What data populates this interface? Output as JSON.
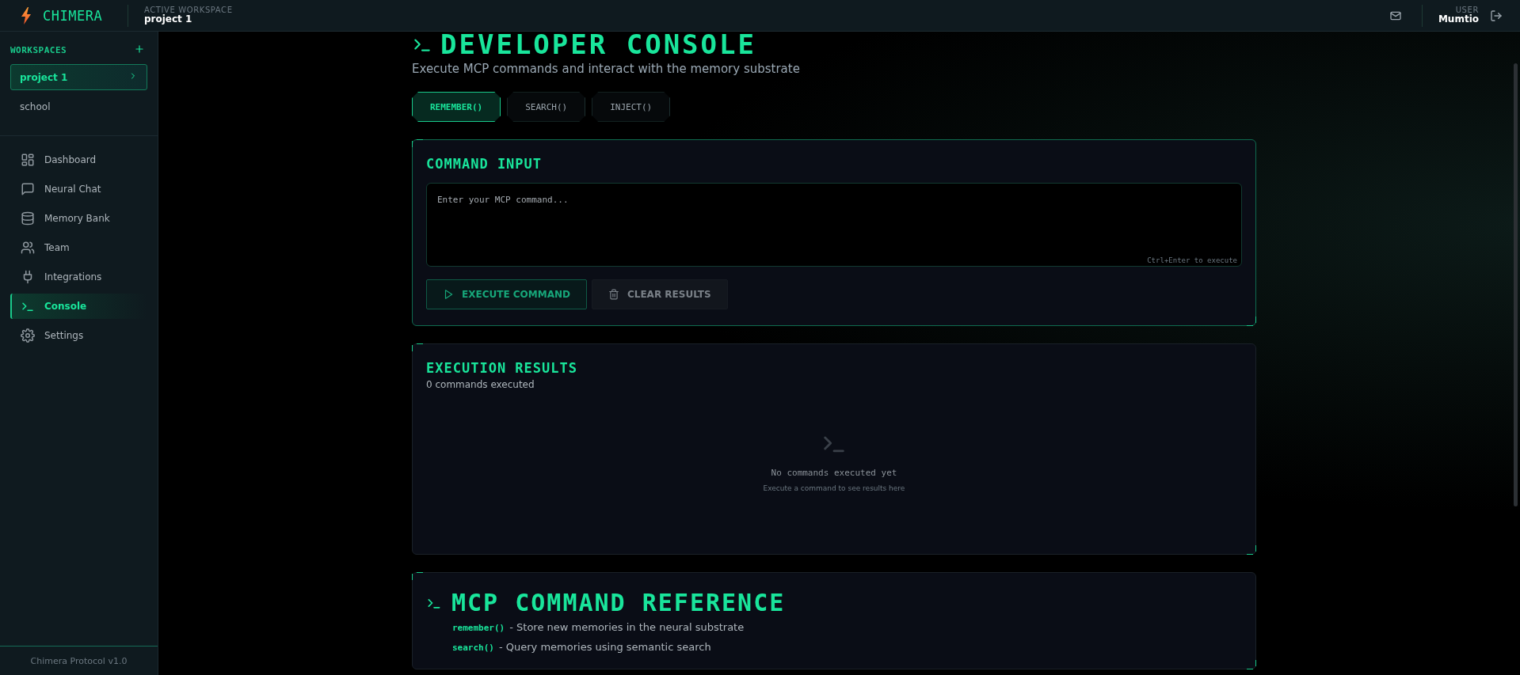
{
  "brand": {
    "name": "CHIMERA"
  },
  "workspace": {
    "label": "ACTIVE WORKSPACE",
    "name": "project 1"
  },
  "user": {
    "label": "USER",
    "name": "Mumtio"
  },
  "sidebar": {
    "workspaces_title": "WORKSPACES",
    "workspaces": [
      {
        "name": "project 1",
        "selected": true
      },
      {
        "name": "school",
        "selected": false
      }
    ],
    "nav": [
      {
        "label": "Dashboard",
        "selected": false
      },
      {
        "label": "Neural Chat",
        "selected": false
      },
      {
        "label": "Memory Bank",
        "selected": false
      },
      {
        "label": "Team",
        "selected": false
      },
      {
        "label": "Integrations",
        "selected": false
      },
      {
        "label": "Console",
        "selected": true
      },
      {
        "label": "Settings",
        "selected": false
      }
    ],
    "footer": "Chimera Protocol v1.0"
  },
  "page": {
    "title": "DEVELOPER CONSOLE",
    "subtitle": "Execute MCP commands and interact with the memory substrate",
    "tabs": [
      {
        "label": "REMEMBER()",
        "selected": true
      },
      {
        "label": "SEARCH()",
        "selected": false
      },
      {
        "label": "INJECT()",
        "selected": false
      }
    ]
  },
  "command_input": {
    "title": "COMMAND INPUT",
    "placeholder": "Enter your MCP command...",
    "hint": "Ctrl+Enter to execute",
    "buttons": [
      {
        "label": "EXECUTE COMMAND",
        "kind": "execute"
      },
      {
        "label": "CLEAR RESULTS",
        "kind": "clear"
      }
    ]
  },
  "results": {
    "title": "EXECUTION RESULTS",
    "count": "0 commands executed",
    "empty_title": "No commands executed yet",
    "empty_hint": "Execute a command to see results here"
  },
  "reference": {
    "title": "MCP COMMAND REFERENCE",
    "commands": [
      {
        "name": "remember()",
        "description": "- Store new memories in the neural substrate"
      },
      {
        "name": "search()",
        "description": "- Query memories using semantic search"
      }
    ]
  }
}
